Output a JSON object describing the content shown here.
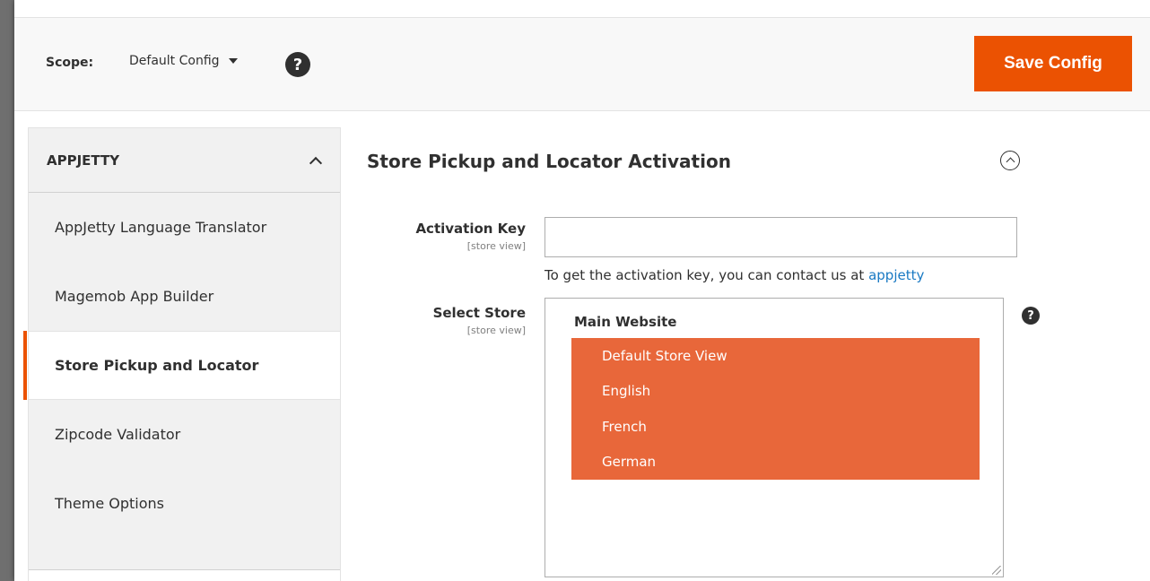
{
  "scope": {
    "label": "Scope:",
    "value": "Default Config",
    "help_glyph": "?"
  },
  "actions": {
    "save_label": "Save Config"
  },
  "sidebar": {
    "group_title": "APPJETTY",
    "items": [
      {
        "label": "AppJetty Language Translator",
        "active": false
      },
      {
        "label": "Magemob App Builder",
        "active": false
      },
      {
        "label": "Store Pickup and Locator",
        "active": true
      },
      {
        "label": "Zipcode Validator",
        "active": false
      },
      {
        "label": "Theme Options",
        "active": false
      }
    ]
  },
  "section": {
    "title": "Store Pickup and Locator Activation"
  },
  "fields": {
    "activation_key": {
      "label": "Activation Key",
      "scope": "[store view]",
      "value": "",
      "note_prefix": "To get the activation key, you can contact us at ",
      "note_link": "appjetty"
    },
    "select_store": {
      "label": "Select Store",
      "scope": "[store view]",
      "group": "Main Website",
      "options": [
        "Default Store View",
        "English",
        "French",
        "German"
      ],
      "help_glyph": "?"
    }
  },
  "colors": {
    "accent": "#eb5202",
    "selected_option": "#e8673a",
    "link": "#1979c3"
  }
}
